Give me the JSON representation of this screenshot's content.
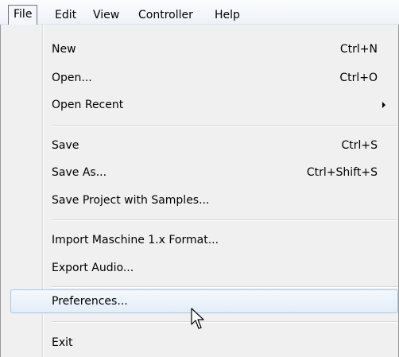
{
  "menubar": {
    "items": [
      {
        "label": "File"
      },
      {
        "label": "Edit"
      },
      {
        "label": "View"
      },
      {
        "label": "Controller"
      },
      {
        "label": "Help"
      }
    ]
  },
  "file_menu": {
    "items": [
      {
        "label": "New",
        "shortcut": "Ctrl+N"
      },
      {
        "label": "Open...",
        "shortcut": "Ctrl+O"
      },
      {
        "label": "Open Recent",
        "submenu_icon": "chevron-right-icon"
      },
      {
        "label": "Save",
        "shortcut": "Ctrl+S"
      },
      {
        "label": "Save As...",
        "shortcut": "Ctrl+Shift+S"
      },
      {
        "label": "Save Project with Samples..."
      },
      {
        "label": "Import Maschine 1.x Format..."
      },
      {
        "label": "Export Audio..."
      },
      {
        "label": "Preferences...",
        "state": "hovered"
      },
      {
        "label": "Exit"
      }
    ]
  },
  "colors": {
    "menu_background": "#f0f0f0",
    "hover_border": "#a8c7ea",
    "hover_fill": "#e3edf9"
  }
}
